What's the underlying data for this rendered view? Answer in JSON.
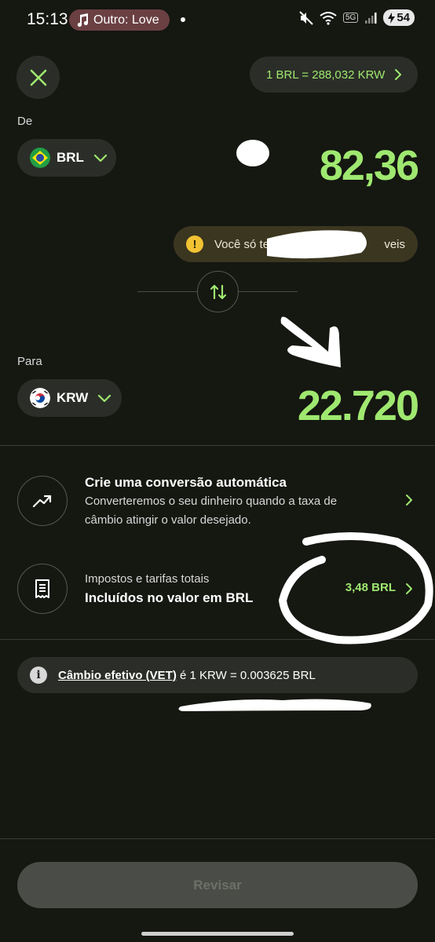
{
  "status_bar": {
    "time": "15:13",
    "media": "Outro: Love",
    "network": "5G",
    "battery": "54"
  },
  "header": {
    "rate": "1 BRL = 288,032 KRW"
  },
  "from": {
    "label": "De",
    "currency": "BRL",
    "amount": "82,36"
  },
  "warning": {
    "text": "Você só te",
    "text_end": "veis"
  },
  "to": {
    "label": "Para",
    "currency": "KRW",
    "amount": "22.720"
  },
  "auto_conversion": {
    "title": "Crie uma conversão automática",
    "subtitle_line1": "Converteremos o seu dinheiro quando a taxa de",
    "subtitle_line2": "câmbio atingir o valor desejado."
  },
  "fees": {
    "label": "Impostos e tarifas totais",
    "title": "Incluídos no valor em BRL",
    "value": "3,48 BRL"
  },
  "vet": {
    "link": "Câmbio efetivo (VET)",
    "text": "é 1 KRW = 0.003625 BRL"
  },
  "footer": {
    "button": "Revisar"
  },
  "colors": {
    "accent": "#9fe870",
    "background": "#151711",
    "surface": "#2b2e28",
    "warning_bg": "#3b3620",
    "warning_icon": "#f1c232"
  },
  "icons": [
    "music-note-icon",
    "mute-icon",
    "wifi-icon",
    "signal-icon",
    "battery-icon",
    "close-icon",
    "chevron-right-icon",
    "chevron-down-icon",
    "brazil-flag-icon",
    "korea-flag-icon",
    "warning-icon",
    "swap-icon",
    "trend-up-icon",
    "receipt-icon",
    "info-icon"
  ]
}
